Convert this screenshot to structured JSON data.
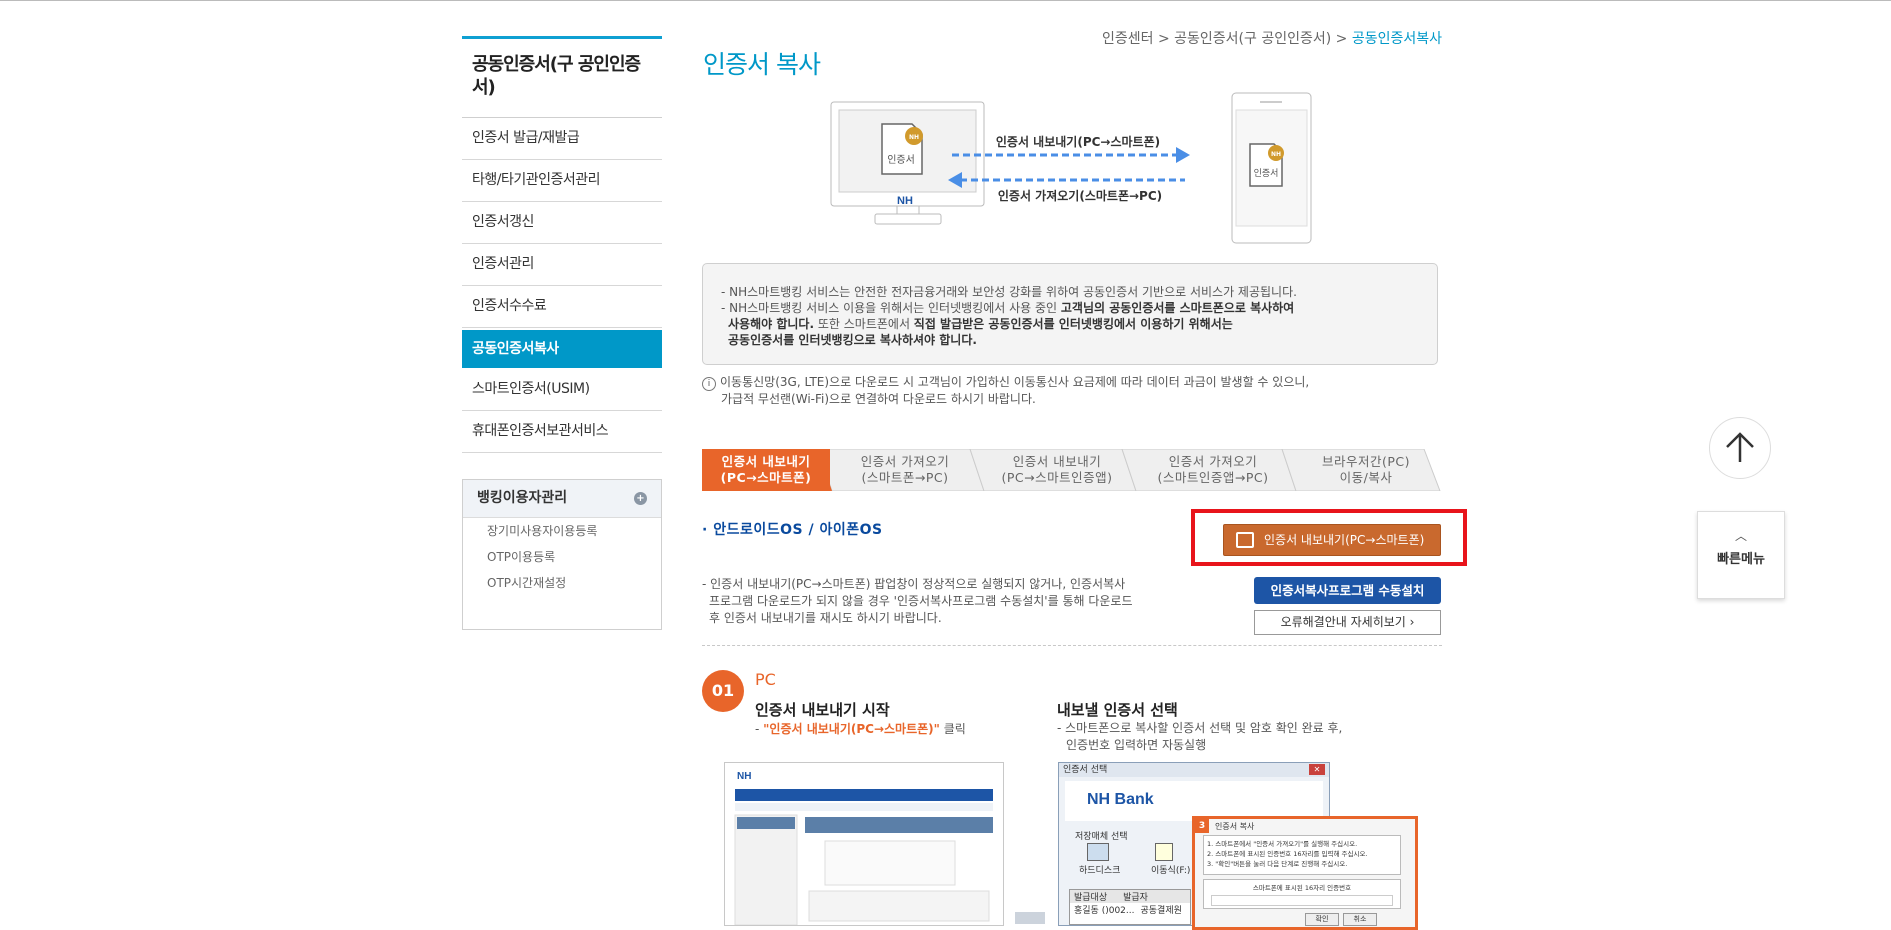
{
  "sidebar": {
    "title": "공동인증서(구 공인인증서)",
    "items": [
      {
        "label": "인증서 발급/재발급"
      },
      {
        "label": "타행/타기관인증서관리"
      },
      {
        "label": "인증서갱신"
      },
      {
        "label": "인증서관리"
      },
      {
        "label": "인증서수수료"
      },
      {
        "label": "공동인증서복사"
      },
      {
        "label": "스마트인증서(USIM)"
      },
      {
        "label": "휴대폰인증서보관서비스"
      }
    ],
    "box": {
      "title": "뱅킹이용자관리",
      "plus_icon": "+",
      "items": [
        "장기미사용자이용등록",
        "OTP이용등록",
        "OTP시간재설정"
      ]
    }
  },
  "breadcrumb": {
    "items": [
      "인증센터",
      "공동인증서(구 공인인증서)",
      "공동인증서복사"
    ],
    "separator": ">"
  },
  "page_title": "인증서 복사",
  "illustration": {
    "export_label": "인증서 내보내기(PC→스마트폰)",
    "import_label": "인증서 가져오기(스마트폰→PC)",
    "cert_label": "인증서",
    "pc_brand": "NH",
    "badge": "NH"
  },
  "info": {
    "line1": "- NH스마트뱅킹 서비스는 안전한 전자금융거래와 보안성 강화를 위하여 공동인증서 기반으로 서비스가 제공됩니다.",
    "line2a": "- NH스마트뱅킹 서비스 이용을 위해서는 인터넷뱅킹에서 사용 중인 ",
    "line2b": "고객님의 공동인증서를 스마트폰으로 복사하여",
    "line3a": "사용해야 합니다.",
    "line3b": " 또한 스마트폰에서 ",
    "line3c": "직접 발급받은 공동인증서를 인터넷뱅킹에서 이용하기 위해서는",
    "line4": "공동인증서를 인터넷뱅킹으로 복사하셔야 합니다."
  },
  "notice": {
    "icon": "i",
    "line1": "이동통신망(3G, LTE)으로 다운로드 시 고객님이 가입하신 이동통신사 요금제에 따라 데이터 과금이 발생할 수 있으니,",
    "line2": "가급적 무선랜(Wi-Fi)으로 연결하여 다운로드 하시기 바랍니다."
  },
  "tabs": [
    {
      "line1": "인증서 내보내기",
      "line2": "(PC→스마트폰)"
    },
    {
      "line1": "인증서 가져오기",
      "line2": "(스마트폰→PC)"
    },
    {
      "line1": "인증서 내보내기",
      "line2": "(PC→스마트인증앱)"
    },
    {
      "line1": "인증서 가져오기",
      "line2": "(스마트인증앱→PC)"
    },
    {
      "line1": "브라우저간(PC)",
      "line2": "이동/복사"
    }
  ],
  "section": {
    "title": "· 안드로이드OS / 아이폰OS",
    "export_button": "인증서 내보내기(PC→스마트폰)",
    "desc1": "- 인증서 내보내기(PC→스마트폰) 팝업창이 정상적으로 실행되지 않거나, 인증서복사",
    "desc2": "프로그램 다운로드가 되지 않을 경우 '인증서복사프로그램 수동설치'를 통해 다운로드",
    "desc3": "후 인증서 내보내기를 재시도 하시기 바랍니다.",
    "manual_button": "인증서복사프로그램 수동설치",
    "error_button": "오류해결안내 자세히보기 ›"
  },
  "step1": {
    "number": "01",
    "label": "PC",
    "title1": "인증서 내보내기 시작",
    "desc1_prefix": "- ",
    "desc1_highlight": "\"인증서 내보내기(PC→스마트폰)\"",
    "desc1_suffix": " 클릭",
    "title2": "내보낼 인증서 선택",
    "desc2_line1": "- 스마트폰으로 복사할 인증서 선택 및 암호 확인 완료 후,",
    "desc2_line2": "인증번호 입력하면 자동실행"
  },
  "screenshot2": {
    "window_title": "인증서 선택",
    "brand": "NH Bank",
    "storage_label": "저장매체 선택",
    "hdd_label": "하드디스크",
    "removable_label": "이동식(F:)",
    "col1": "발급대상",
    "col2": "발급자",
    "row1_col1": "홍길동 ()002...",
    "row1_col2": "공동결제원"
  },
  "screenshot3": {
    "title": "인증서 복사",
    "badge": "3",
    "line1": "1. 스마트폰에서 \"인증서 가져오기\"를 실행해 주십시오.",
    "line2": "2. 스마트폰에 표시된 인증번호 16자리를 입력해 주십시오.",
    "line3": "3. \"확인\"버튼을 눌러 다음 단계로 진행해 주십시오.",
    "field_label": "스마트폰에 표시된 16자리 인증번호",
    "ok": "확인",
    "cancel": "취소"
  },
  "float": {
    "quick_menu": "빠른메뉴"
  },
  "colors": {
    "accent_blue": "#0098c8",
    "accent_orange": "#e8652a",
    "navy_button": "#1d55a6",
    "highlight_red": "#e8141b"
  }
}
